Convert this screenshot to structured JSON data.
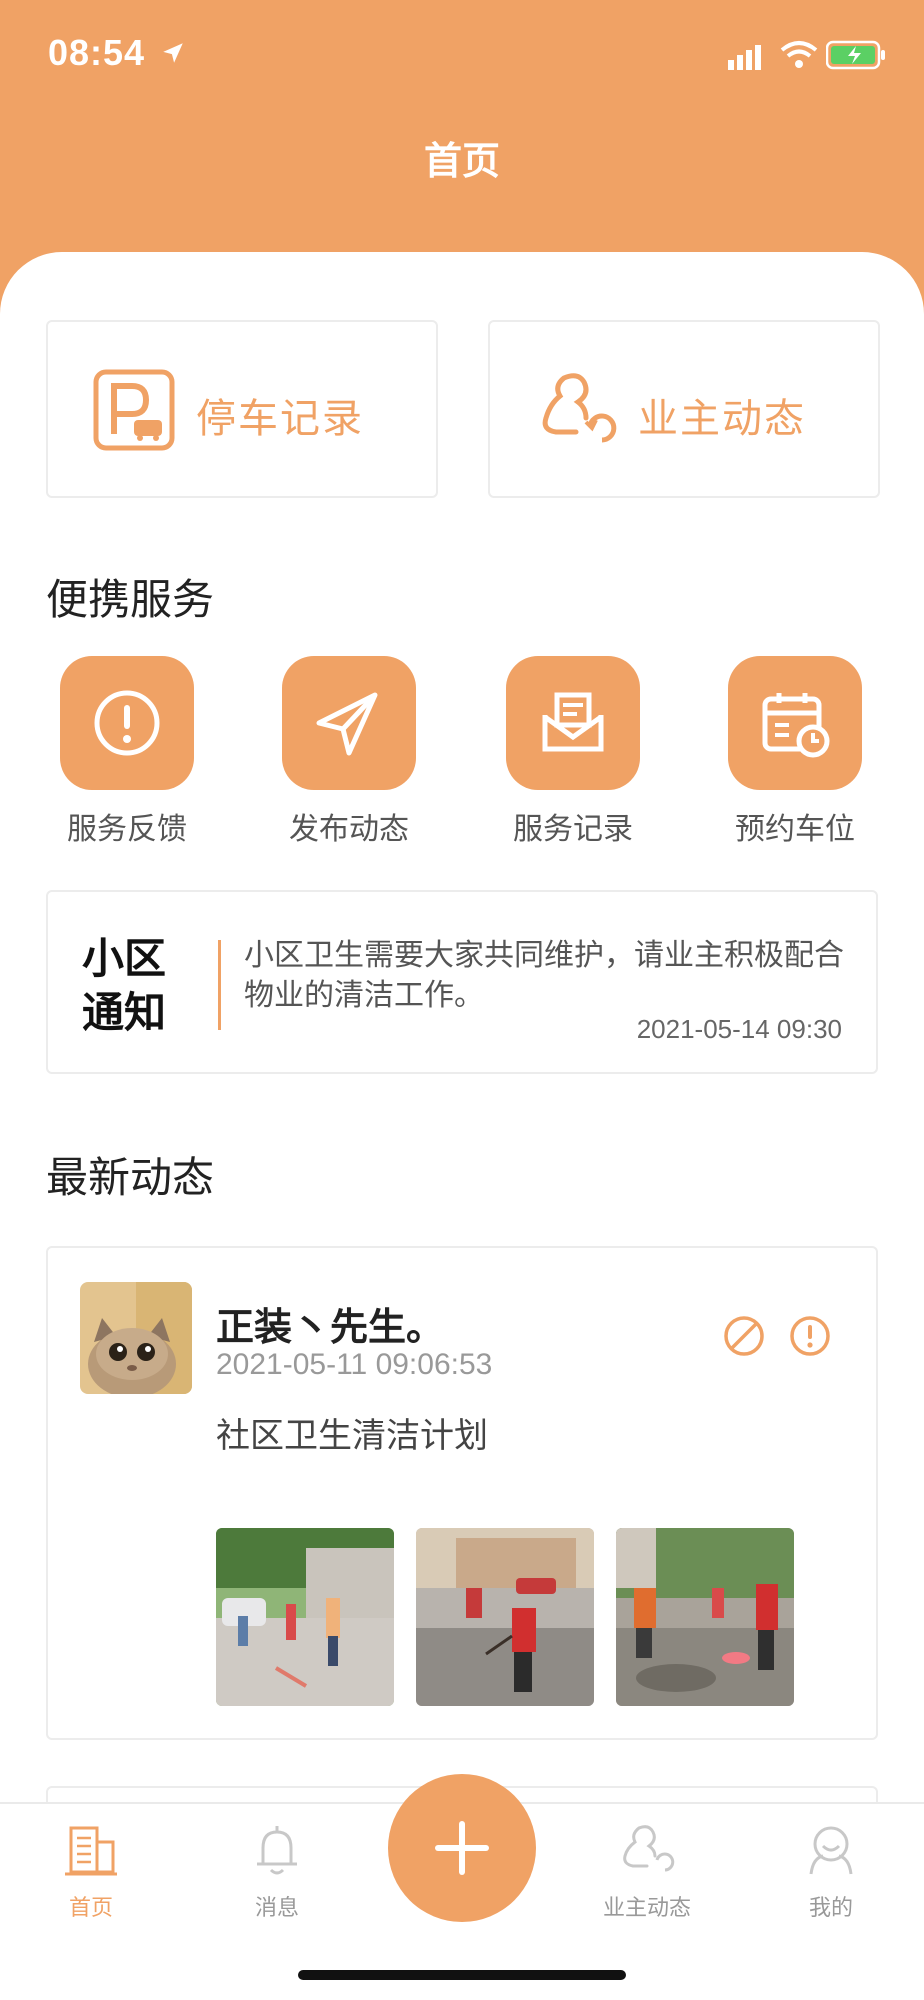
{
  "status_bar": {
    "time": "08:54"
  },
  "nav": {
    "title": "首页"
  },
  "quick_cards": [
    {
      "label": "停车记录",
      "icon": "parking-icon"
    },
    {
      "label": "业主动态",
      "icon": "owner-icon"
    }
  ],
  "services": {
    "title": "便携服务",
    "items": [
      {
        "label": "服务反馈",
        "icon": "alert-icon"
      },
      {
        "label": "发布动态",
        "icon": "send-icon"
      },
      {
        "label": "服务记录",
        "icon": "mail-icon"
      },
      {
        "label": "预约车位",
        "icon": "calendar-icon"
      }
    ]
  },
  "notice": {
    "label_line1": "小区",
    "label_line2": "通知",
    "text": "小区卫生需要大家共同维护，请业主积极配合物业的清洁工作。",
    "time": "2021-05-14 09:30"
  },
  "feed": {
    "title": "最新动态",
    "posts": [
      {
        "author": "正装丶先生。",
        "time": "2021-05-11 09:06:53",
        "text": "社区卫生清洁计划"
      }
    ]
  },
  "tabbar": {
    "items": [
      {
        "label": "首页",
        "icon": "building-icon",
        "active": true
      },
      {
        "label": "消息",
        "icon": "bell-icon",
        "active": false
      },
      {
        "label": "业主动态",
        "icon": "owner-icon",
        "active": false
      },
      {
        "label": "我的",
        "icon": "profile-icon",
        "active": false
      }
    ]
  },
  "colors": {
    "accent": "#f0a265",
    "text": "#222222",
    "muted": "#999999"
  }
}
